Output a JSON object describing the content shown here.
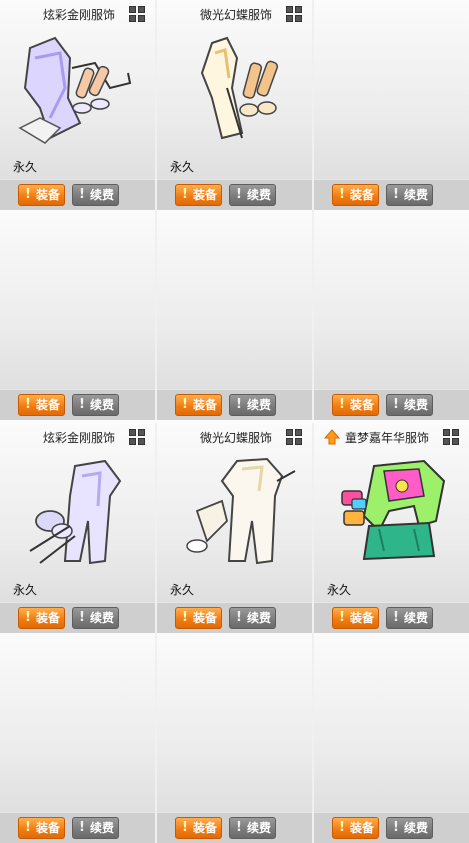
{
  "labels": {
    "equip": "装备",
    "renew": "续费",
    "exclaim": "!"
  },
  "panel1": {
    "slots": [
      {
        "name": "炫彩金刚服饰",
        "duration": "永久",
        "icon": "grid-icon",
        "art": "iridescent-costume"
      },
      {
        "name": "微光幻蝶服饰",
        "duration": "永久",
        "icon": "grid-icon",
        "art": "golden-butterfly-costume"
      }
    ]
  },
  "panel2": {
    "slots": [
      {
        "name": "炫彩金刚服饰",
        "duration": "永久",
        "icon": "grid-icon",
        "art": "iridescent-costume"
      },
      {
        "name": "微光幻蝶服饰",
        "duration": "永久",
        "icon": "grid-icon",
        "art": "white-butterfly-costume"
      },
      {
        "name": "童梦嘉年华服饰",
        "duration": "永久",
        "icon": "grid-icon",
        "badge": "upgrade-arrow-icon",
        "art": "carnival-costume"
      }
    ]
  },
  "colors": {
    "equip": "#f07a12",
    "renew": "#7a7a7a"
  }
}
